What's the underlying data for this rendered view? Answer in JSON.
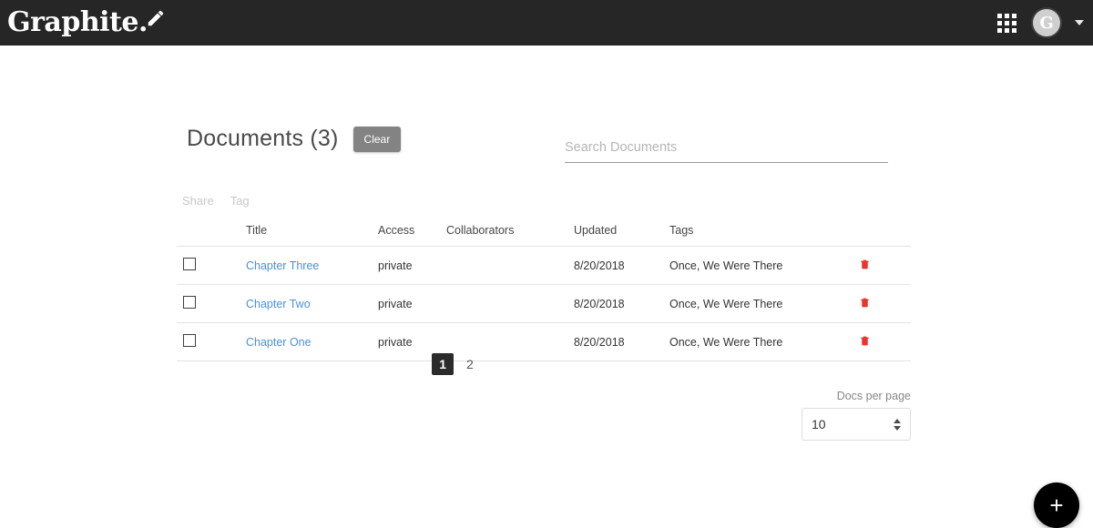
{
  "header": {
    "brand_text": "Graphite.",
    "pencil_icon": "pencil-icon",
    "apps_icon": "apps-grid-icon",
    "avatar_initial": "G",
    "caret_icon": "chevron-down-icon",
    "background_color": "#262626"
  },
  "main": {
    "page_title": "Documents (3)",
    "clear_label": "Clear",
    "search": {
      "placeholder": "Search Documents",
      "value": ""
    },
    "bulk_actions": [
      {
        "label": "Share",
        "enabled": false
      },
      {
        "label": "Tag",
        "enabled": false
      }
    ],
    "table": {
      "columns": [
        "",
        "Title",
        "Access",
        "Collaborators",
        "Updated",
        "Tags",
        ""
      ],
      "rows": [
        {
          "checked": false,
          "title": "Chapter Three",
          "access": "private",
          "collaborators": "",
          "updated": "8/20/2018",
          "tags": "Once, We Were There",
          "delete_icon": "trash-icon"
        },
        {
          "checked": false,
          "title": "Chapter Two",
          "access": "private",
          "collaborators": "",
          "updated": "8/20/2018",
          "tags": "Once, We Were There",
          "delete_icon": "trash-icon"
        },
        {
          "checked": false,
          "title": "Chapter One",
          "access": "private",
          "collaborators": "",
          "updated": "8/20/2018",
          "tags": "Once, We Were There",
          "delete_icon": "trash-icon"
        }
      ]
    },
    "pagination": {
      "pages": [
        "1",
        "2"
      ],
      "active_page": "1"
    },
    "docs_per_page": {
      "label": "Docs per page",
      "value": "10"
    },
    "fab_label": "+",
    "link_color": "#4a90d9",
    "delete_color": "#e8352e"
  }
}
